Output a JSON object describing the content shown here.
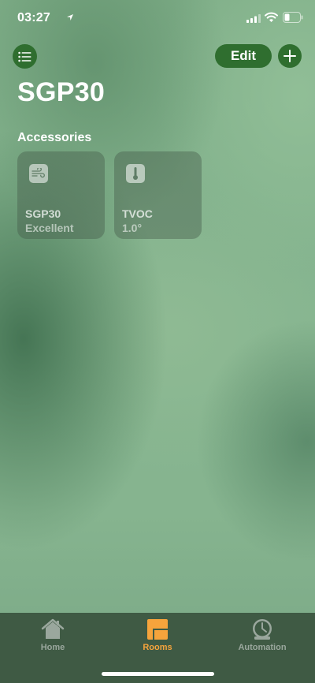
{
  "status_bar": {
    "time": "03:27"
  },
  "header": {
    "edit_label": "Edit",
    "title": "SGP30"
  },
  "section": {
    "label": "Accessories"
  },
  "tiles": [
    {
      "name": "SGP30",
      "status": "Excellent",
      "icon": "air-quality-icon"
    },
    {
      "name": "TVOC",
      "status": "1.0°",
      "icon": "thermometer-icon"
    }
  ],
  "tab_bar": {
    "tabs": [
      {
        "label": "Home",
        "icon": "home-icon",
        "selected": false
      },
      {
        "label": "Rooms",
        "icon": "rooms-icon",
        "selected": true
      },
      {
        "label": "Automation",
        "icon": "automation-clock-icon",
        "selected": false
      }
    ]
  },
  "colors": {
    "accent_button": "#2f6e2f",
    "selected_tab": "#f6a43c",
    "tab_bar": "#3f5a44"
  }
}
